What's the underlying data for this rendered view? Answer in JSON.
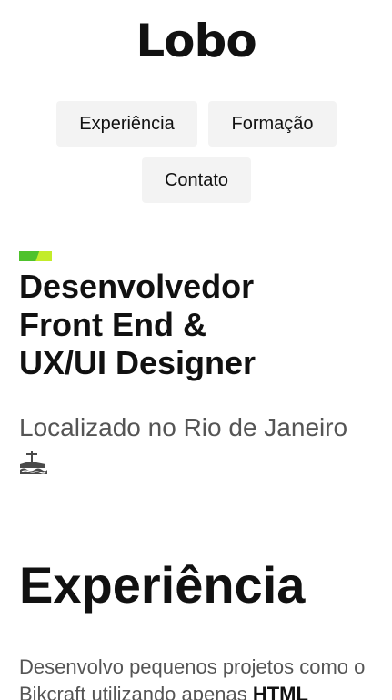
{
  "header": {
    "logo": "Lobo"
  },
  "nav": {
    "items": [
      {
        "label": "Experiência"
      },
      {
        "label": "Formação"
      },
      {
        "label": "Contato"
      }
    ]
  },
  "hero": {
    "title_lines": [
      "Desenvolvedor",
      "Front End &",
      "UX/UI Designer"
    ],
    "location": "Localizado no Rio de Janeiro",
    "location_icon": "rio-landmark-icon",
    "accent_colors": [
      "#4ec22c",
      "#c3ec2a"
    ]
  },
  "experience": {
    "title": "Experiência",
    "paragraph_lead": "Desenvolvo pequenos projetos como o Bikcraft utilizando apenas",
    "paragraph_strong": "HTML"
  }
}
